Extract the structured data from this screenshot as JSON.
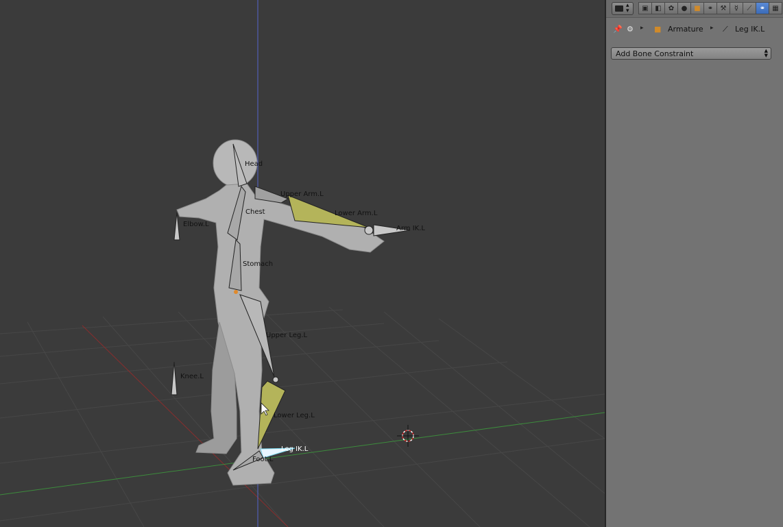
{
  "viewport": {
    "bones": [
      {
        "label": "Head"
      },
      {
        "label": "Upper Arm.L"
      },
      {
        "label": "Chest"
      },
      {
        "label": "Lower Arm.L"
      },
      {
        "label": "Arm IK.L"
      },
      {
        "label": "Elbow.L"
      },
      {
        "label": "Stomach"
      },
      {
        "label": "Upper Leg.L"
      },
      {
        "label": "Knee.L"
      },
      {
        "label": "Lower Leg.L"
      },
      {
        "label": "Leg IK.L"
      },
      {
        "label": "Foot.L"
      }
    ]
  },
  "properties": {
    "header": {
      "tab_icons": [
        "render-icon",
        "render-layers-icon",
        "scene-icon",
        "world-icon",
        "object-icon",
        "constraints-icon",
        "modifiers-icon",
        "armature-data-icon",
        "bone-icon",
        "bone-constraint-icon",
        "texture-icon"
      ],
      "active_tab": "bone-constraint-icon"
    },
    "breadcrumb": {
      "object": "Armature",
      "bone": "Leg IK.L"
    },
    "add_constraint_label": "Add Bone Constraint"
  },
  "colors": {
    "viewport_bg": "#3b3b3b",
    "panel_bg": "#737373",
    "selected_bone": "#b4b45a",
    "active_bone": "#7ad7ee",
    "x_axis": "#8a2d2d",
    "y_axis": "#3c8c3c"
  }
}
